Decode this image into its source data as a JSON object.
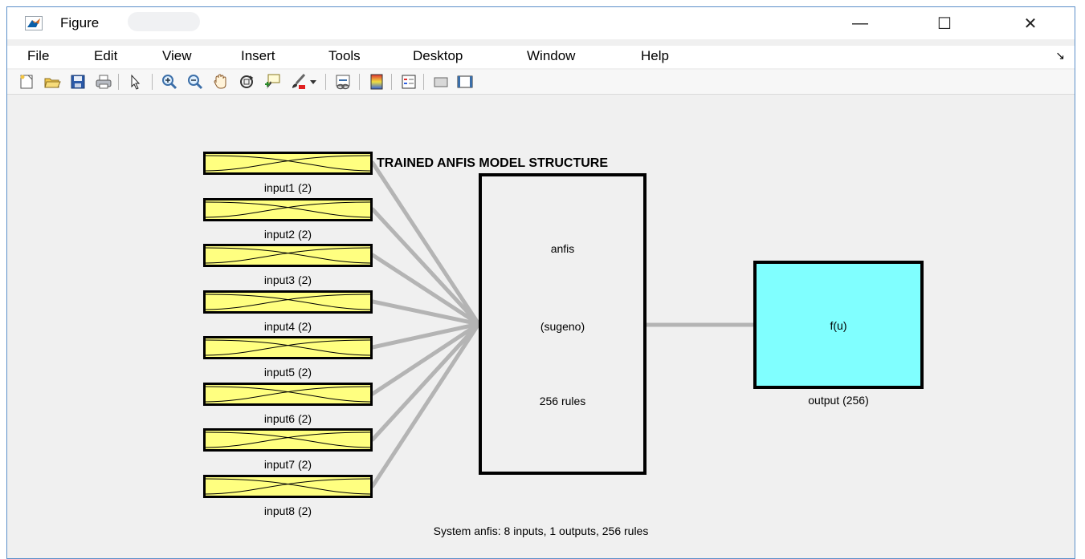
{
  "window": {
    "title": "Figure",
    "minimize_glyph": "—",
    "maximize_glyph": "☐",
    "close_glyph": "✕"
  },
  "menu": {
    "items": [
      "File",
      "Edit",
      "View",
      "Insert",
      "Tools",
      "Desktop",
      "Window",
      "Help"
    ],
    "overflow_glyph": "↘"
  },
  "toolbar": {
    "icons": [
      "new-figure-icon",
      "open-file-icon",
      "save-icon",
      "print-icon",
      "edit-plot-arrow-icon",
      "zoom-in-icon",
      "zoom-out-icon",
      "pan-hand-icon",
      "rotate-3d-icon",
      "data-cursor-icon",
      "brush-icon",
      "brush-dropdown-icon",
      "link-plot-icon",
      "insert-colorbar-icon",
      "insert-legend-icon",
      "hide-plot-tools-icon",
      "show-plot-tools-icon"
    ]
  },
  "diagram": {
    "title": "TRAINED ANFIS MODEL STRUCTURE",
    "inputs": [
      "input1 (2)",
      "input2 (2)",
      "input3 (2)",
      "input4 (2)",
      "input5 (2)",
      "input6 (2)",
      "input7 (2)",
      "input8 (2)"
    ],
    "system": {
      "name": "anfis",
      "type": "(sugeno)",
      "rules": "256 rules"
    },
    "output": {
      "function": "f(u)",
      "label": "output (256)"
    },
    "summary": "System anfis: 8 inputs, 1 outputs, 256 rules",
    "colors": {
      "input_fill": "#ffff80",
      "output_fill": "#80ffff",
      "connector": "#b4b4b4"
    }
  }
}
